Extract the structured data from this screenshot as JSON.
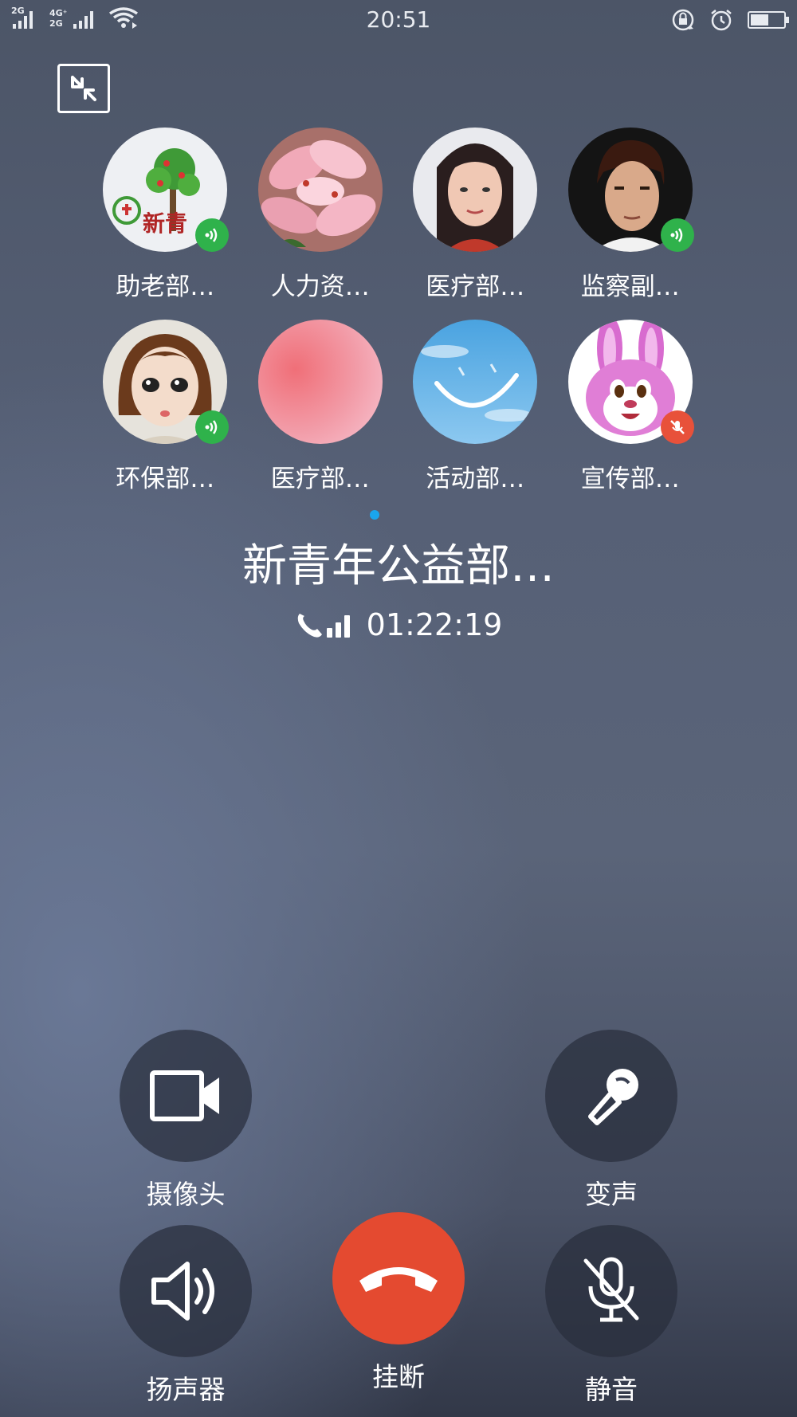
{
  "status_bar": {
    "sim1_type": "2G",
    "sim2_type_top": "4G⁺",
    "sim2_type_bottom": "2G",
    "time": "20:51",
    "battery_level": 0.55,
    "icons": [
      "signal-icon",
      "wifi-icon",
      "rotation-lock-icon",
      "alarm-icon",
      "battery-icon"
    ]
  },
  "members": [
    {
      "name": "助老部…",
      "status": "speaking",
      "avatar": "tree-logo"
    },
    {
      "name": "人力资…",
      "status": "none",
      "avatar": "lily-flowers"
    },
    {
      "name": "医疗部…",
      "status": "none",
      "avatar": "woman-portrait"
    },
    {
      "name": "监察副…",
      "status": "speaking",
      "avatar": "man-portrait"
    },
    {
      "name": "环保部…",
      "status": "speaking",
      "avatar": "cartoon-girl"
    },
    {
      "name": "医疗部…",
      "status": "none",
      "avatar": "pink-gradient"
    },
    {
      "name": "活动部…",
      "status": "none",
      "avatar": "sky-smile"
    },
    {
      "name": "宣传部…",
      "status": "muted",
      "avatar": "cartoon-rabbit"
    }
  ],
  "call": {
    "group_name": "新青年公益部…",
    "duration": "01:22:19"
  },
  "controls": {
    "camera": "摄像头",
    "voice_change": "变声",
    "speaker": "扬声器",
    "hangup": "挂断",
    "mute": "静音"
  },
  "colors": {
    "speaking_badge": "#2fb24b",
    "muted_badge": "#e8513a",
    "hangup_button": "#e44a30",
    "pager_dot": "#1aa5ee"
  }
}
